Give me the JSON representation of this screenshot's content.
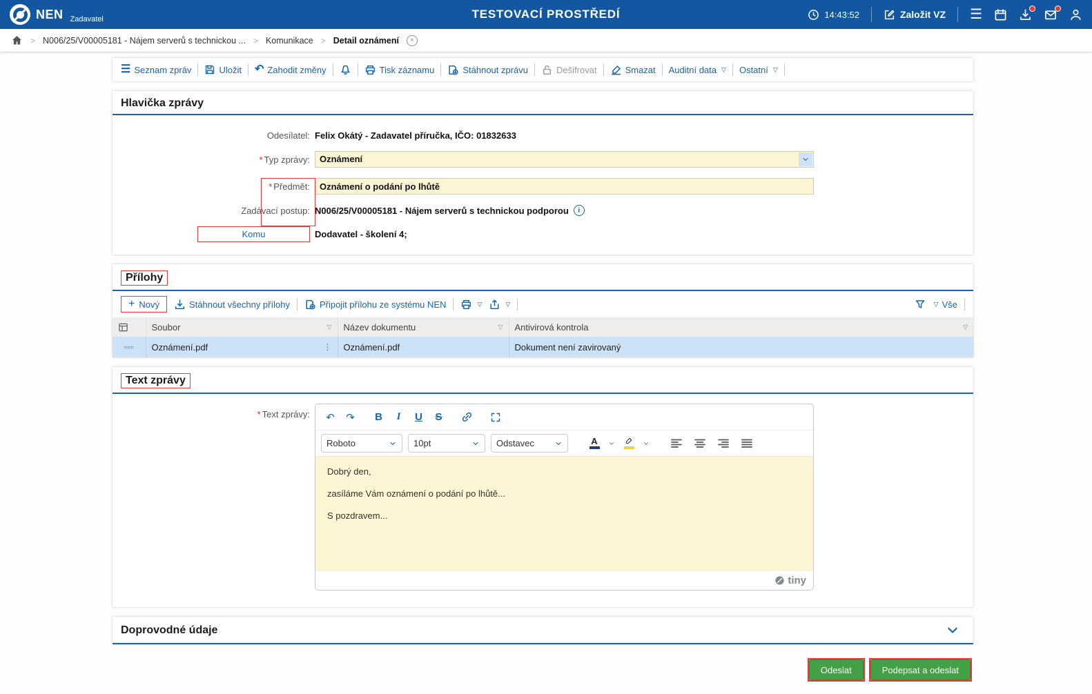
{
  "colors": {
    "header": "#12579f",
    "accent": "#1565b0",
    "yellow": "#fcf5d3",
    "selected_row": "#cde2f6",
    "green": "#43a047",
    "annotation": "#e53935",
    "badge": "#e8392e"
  },
  "icons": {
    "hamburger": "☰",
    "undo": "↶",
    "redo": "↷",
    "chevron_small": "▽",
    "breadcrumb_sep": ">",
    "plus": "+",
    "close": "×",
    "info": "i",
    "dots_vertical": "⋮",
    "row_handle": "○○○",
    "asterisk": "*",
    "bold": "B",
    "italic": "I",
    "underline": "U",
    "strike": "S",
    "color_letter": "A"
  },
  "header": {
    "brand": "NEN",
    "brand_sub": "Zadavatel",
    "env_title": "TESTOVACÍ PROSTŘEDÍ",
    "time": "14:43:52",
    "create_vz": "Založit VZ"
  },
  "breadcrumb": {
    "item1": "N006/25/V00005181 - Nájem serverů s technickou ...",
    "item2": "Komunikace",
    "item3": "Detail oznámení"
  },
  "toolbar": {
    "seznam": "Seznam zpráv",
    "ulozit": "Uložit",
    "zahodit": "Zahodit změny",
    "tisk": "Tisk záznamu",
    "stahnout": "Stáhnout zprávu",
    "desifrovat": "Dešifrovat",
    "smazat": "Smazat",
    "auditni": "Auditní data",
    "ostatni": "Ostatní"
  },
  "message_header": {
    "title": "Hlavička zprávy",
    "odesilatel_label": "Odesílatel:",
    "odesilatel_value": "Felix Okátý - Zadavatel příručka, IČO: 01832633",
    "typ_label": "Typ zprávy:",
    "typ_value": "Oznámení",
    "predmet_label": "Předmět:",
    "predmet_value": "Oznámení o podání po lhůtě",
    "postup_label": "Zadávací postup:",
    "postup_value": "N006/25/V00005181 - Nájem serverů s technickou podporou",
    "komu_label": "Komu",
    "komu_value": "Dodavatel - školení 4;"
  },
  "attachments": {
    "title": "Přílohy",
    "novy": "Nový",
    "stahnout_vse": "Stáhnout všechny přílohy",
    "pripojit": "Připojit přílohu ze systému NEN",
    "vse": "Vše",
    "columns": {
      "soubor": "Soubor",
      "nazev": "Název dokumentu",
      "antivir": "Antivirová kontrola"
    },
    "row": {
      "soubor": "Oznámení.pdf",
      "nazev": "Oznámení.pdf",
      "antivir": "Dokument není zavirovaný"
    }
  },
  "message_text": {
    "title": "Text zprávy",
    "label": "Text zprávy:",
    "font": "Roboto",
    "size": "10pt",
    "format": "Odstavec",
    "line1": "Dobrý den,",
    "line2": "zasíláme Vám oznámení o podání po lhůtě...",
    "line3": "S pozdravem...",
    "tiny": "tiny"
  },
  "additional": {
    "title": "Doprovodné údaje"
  },
  "actions": {
    "odeslat": "Odeslat",
    "podepsat": "Podepsat a odeslat"
  }
}
